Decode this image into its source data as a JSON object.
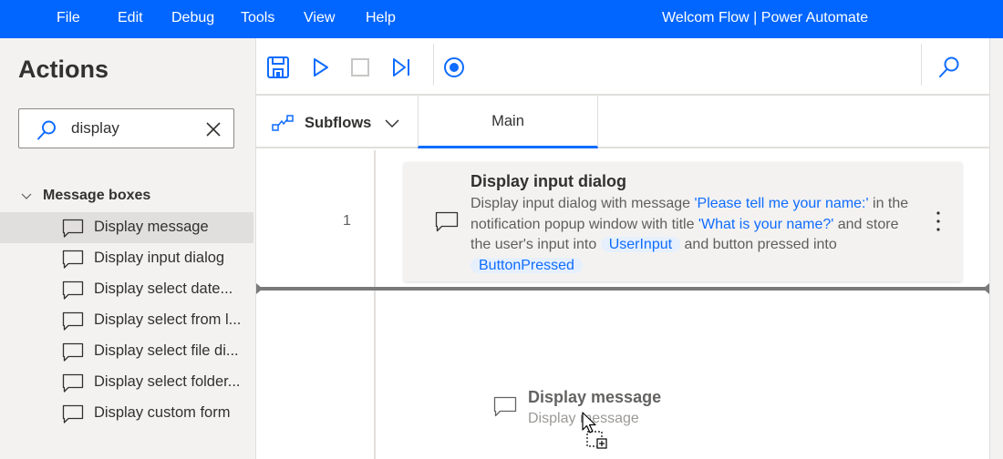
{
  "menubar": {
    "items": [
      "File",
      "Edit",
      "Debug",
      "Tools",
      "View",
      "Help"
    ],
    "window_title": "Welcom Flow | Power Automate",
    "background_color": "#0066ff"
  },
  "sidebar": {
    "title": "Actions",
    "search": {
      "value": "display",
      "icon": "search-icon",
      "clear_icon": "close-icon"
    },
    "group": {
      "label": "Message boxes",
      "expanded": true,
      "items": [
        {
          "label": "Display message",
          "icon": "message-icon",
          "selected": true
        },
        {
          "label": "Display input dialog",
          "icon": "message-icon",
          "selected": false
        },
        {
          "label": "Display select date...",
          "icon": "message-icon",
          "selected": false
        },
        {
          "label": "Display select from l...",
          "icon": "message-icon",
          "selected": false
        },
        {
          "label": "Display select file di...",
          "icon": "message-icon",
          "selected": false
        },
        {
          "label": "Display select folder...",
          "icon": "message-icon",
          "selected": false
        },
        {
          "label": "Display custom form",
          "icon": "message-icon",
          "selected": false
        }
      ]
    }
  },
  "toolbar": {
    "buttons": [
      "save-icon",
      "run-icon",
      "stop-icon",
      "run-next-action-icon",
      "record-icon"
    ],
    "search_icon": "search-icon",
    "accent_color": "#0f6cff"
  },
  "tabs": {
    "subflows_label": "Subflows",
    "active_tab": "Main"
  },
  "flow": {
    "steps": [
      {
        "number": "1",
        "title": "Display input dialog",
        "description": {
          "t1": "Display input dialog with message ",
          "message": "'Please tell me your name:'",
          "t2": " in the notification popup window with title ",
          "window_title": "'What is your name?'",
          "t3": " and store the user's input into ",
          "var1": "UserInput",
          "t4": " and button pressed into ",
          "var2": "ButtonPressed"
        }
      }
    ],
    "drag_ghost": {
      "title": "Display message",
      "subtitle": "Display message"
    }
  }
}
